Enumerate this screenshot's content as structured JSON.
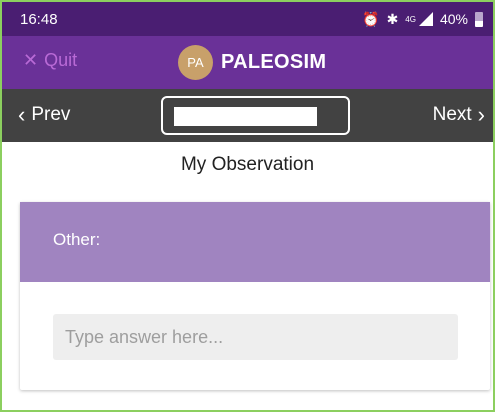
{
  "status_bar": {
    "time": "16:48",
    "icons": [
      "alarm-icon",
      "bluetooth-icon",
      "signal-icon",
      "battery-icon"
    ],
    "network": "4G",
    "battery": "40%"
  },
  "app_bar": {
    "quit_label": "Quit",
    "badge_text": "PA",
    "title": "PALEOSIM"
  },
  "nav": {
    "prev_label": "Prev",
    "next_label": "Next",
    "page_value": ""
  },
  "main": {
    "title": "My Observation",
    "card": {
      "label": "Other:",
      "placeholder": "Type answer here...",
      "value": ""
    }
  },
  "colors": {
    "status_bar": "#4a1e72",
    "app_bar": "#6a3198",
    "nav_bar": "#424242",
    "card_header": "#a084c0",
    "quit": "#b96ad6",
    "badge": "#c8a06a",
    "frame_border": "#8ccf5f"
  }
}
